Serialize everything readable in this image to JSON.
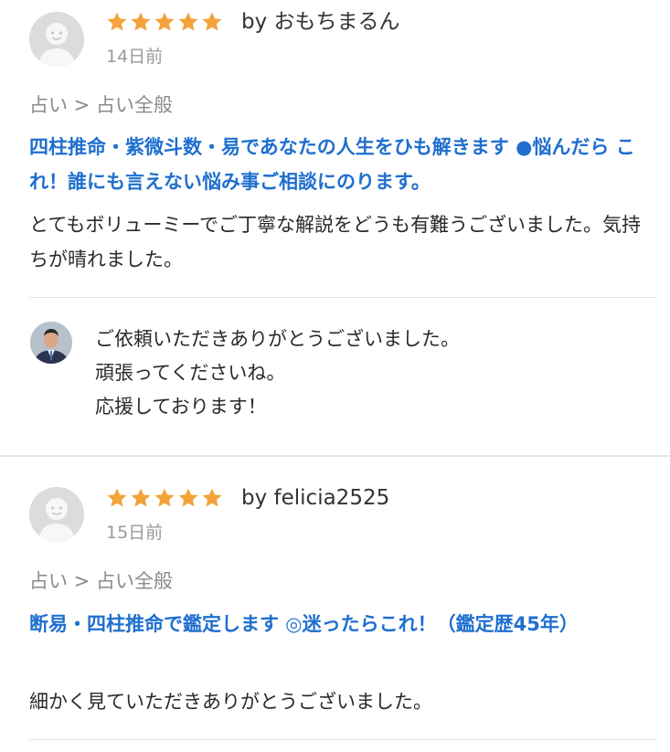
{
  "reviews": [
    {
      "stars": 5,
      "byline": "by おもちまるん",
      "date": "14日前",
      "category": "占い > 占い全般",
      "title": "四柱推命・紫微斗数・易であなたの人生をひも解きます ●悩んだら これ！誰にも言えない悩み事ご相談にのります。",
      "body": "とてもボリューミーでご丁寧な解説をどうも有難うございました。気持ちが晴れました。",
      "reply": [
        "ご依頼いただきありがとうございました。",
        "頑張ってくださいね。",
        "応援しております！"
      ]
    },
    {
      "stars": 5,
      "byline": "by felicia2525",
      "date": "15日前",
      "category": "占い > 占い全般",
      "title": "断易・四柱推命で鑑定します ◎迷ったらこれ！（鑑定歴45年）",
      "body": "細かく見ていただきありがとうございました。"
    }
  ],
  "colors": {
    "star": "#f3a33a",
    "title": "#1f6fcf",
    "meta": "#9a9a9a"
  },
  "icons": {
    "star": "star-icon",
    "avatar": "default-user-avatar-icon",
    "seller": "seller-photo"
  }
}
